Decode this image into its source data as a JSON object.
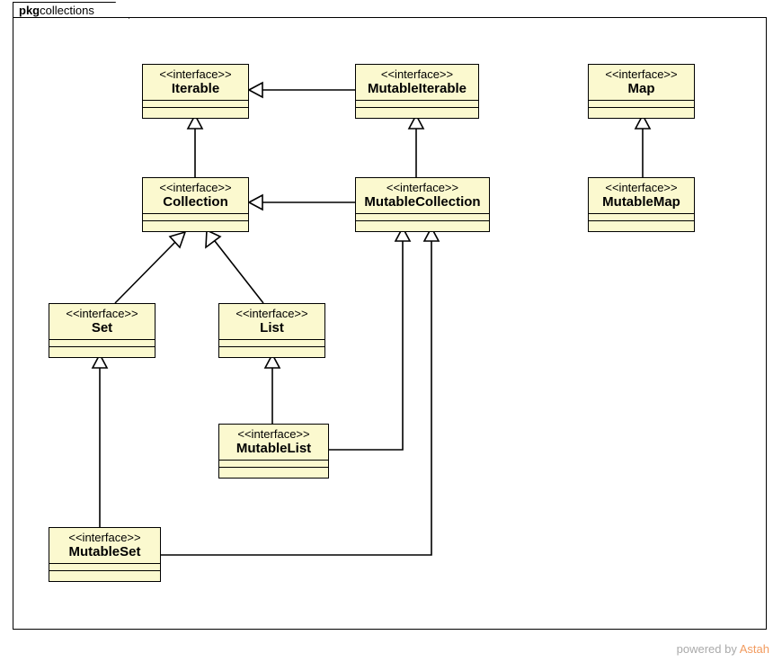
{
  "package": {
    "prefix": "pkg",
    "name": "collections"
  },
  "stereotype": "<<interface>>",
  "nodes": {
    "iterable": "Iterable",
    "mutableIterable": "MutableIterable",
    "map": "Map",
    "collection": "Collection",
    "mutableCollection": "MutableCollection",
    "mutableMap": "MutableMap",
    "set": "Set",
    "list": "List",
    "mutableList": "MutableList",
    "mutableSet": "MutableSet"
  },
  "footer": {
    "text": "powered by ",
    "brand": "Astah"
  },
  "chart_data": {
    "type": "uml-class-diagram",
    "package": "collections",
    "interfaces": [
      "Iterable",
      "MutableIterable",
      "Map",
      "Collection",
      "MutableCollection",
      "MutableMap",
      "Set",
      "List",
      "MutableList",
      "MutableSet"
    ],
    "generalizations": [
      {
        "child": "MutableIterable",
        "parent": "Iterable"
      },
      {
        "child": "Collection",
        "parent": "Iterable"
      },
      {
        "child": "MutableCollection",
        "parent": "MutableIterable"
      },
      {
        "child": "MutableCollection",
        "parent": "Collection"
      },
      {
        "child": "MutableMap",
        "parent": "Map"
      },
      {
        "child": "Set",
        "parent": "Collection"
      },
      {
        "child": "List",
        "parent": "Collection"
      },
      {
        "child": "MutableList",
        "parent": "List"
      },
      {
        "child": "MutableList",
        "parent": "MutableCollection"
      },
      {
        "child": "MutableSet",
        "parent": "Set"
      },
      {
        "child": "MutableSet",
        "parent": "MutableCollection"
      }
    ]
  }
}
